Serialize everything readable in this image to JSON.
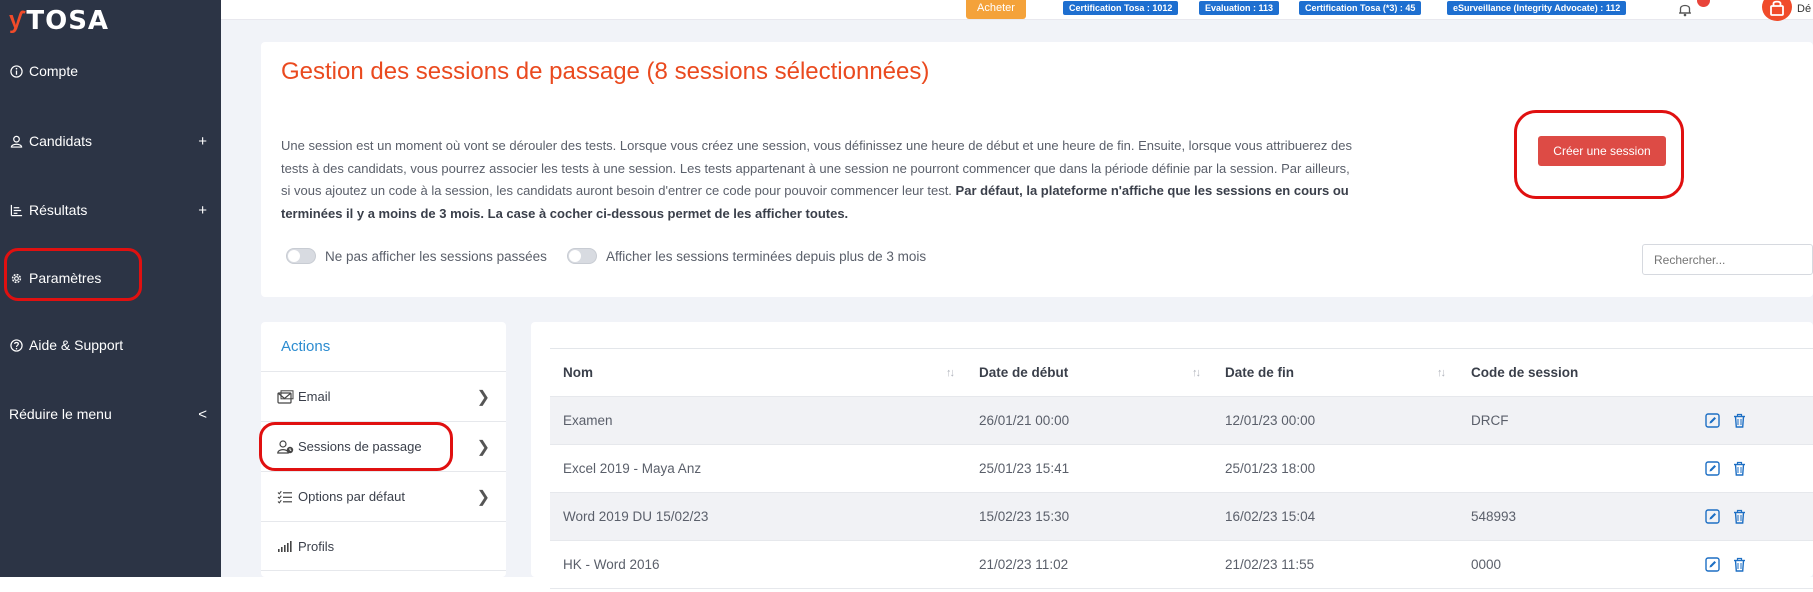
{
  "brand": {
    "name": "TOSA",
    "accent": "#f04b2a"
  },
  "sidebar": {
    "items": [
      {
        "label": "Compte",
        "icon": "info-icon"
      },
      {
        "label": "Candidats",
        "icon": "user-icon",
        "expand": "+"
      },
      {
        "label": "Résultats",
        "icon": "results-icon",
        "expand": "+"
      },
      {
        "label": "Paramètres",
        "icon": "gear-icon"
      },
      {
        "label": "Aide & Support",
        "icon": "help-icon"
      },
      {
        "label": "Réduire le menu",
        "icon": "",
        "expand": "<"
      }
    ]
  },
  "topbar": {
    "buy_label": "Acheter",
    "badges": [
      "Certification Tosa : 1012",
      "Evaluation : 113",
      "Certification Tosa (*3) : 45",
      "eSurveillance (Integrity Advocate) : 112"
    ],
    "user_name": "Dé"
  },
  "header": {
    "title": "Gestion des sessions de passage (8 sessions sélectionnées)",
    "description": "Une session est un moment où vont se dérouler des tests. Lorsque vous créez une session, vous définissez une heure de début et une heure de fin. Ensuite, lorsque vous attribuerez des tests à des candidats, vous pourrez associer les tests à une session. Les tests appartenant à une session ne pourront commencer que dans la période définie par la session. Par ailleurs, si vous ajoutez un code à la session, les candidats auront besoin d'entrer ce code pour pouvoir commencer leur test.",
    "description_bold": "Par défaut, la plateforme n'affiche que les sessions en cours ou terminées il y a moins de 3 mois. La case à cocher ci-dessous permet de les afficher toutes.",
    "create_button": "Créer une session",
    "toggle_past": "Ne pas afficher les sessions passées",
    "toggle_old": "Afficher les sessions terminées depuis plus de 3 mois",
    "search_placeholder": "Rechercher..."
  },
  "actions": {
    "title": "Actions",
    "items": [
      {
        "label": "Email",
        "icon": "email-icon"
      },
      {
        "label": "Sessions de passage",
        "icon": "session-user-icon"
      },
      {
        "label": "Options par défaut",
        "icon": "checklist-icon"
      },
      {
        "label": "Profils",
        "icon": "signal-bars-icon"
      }
    ]
  },
  "table": {
    "columns": [
      "Nom",
      "Date de début",
      "Date de fin",
      "Code de session"
    ],
    "rows": [
      {
        "nom": "Examen",
        "debut": "26/01/21 00:00",
        "fin": "12/01/23 00:00",
        "code": "DRCF"
      },
      {
        "nom": "Excel 2019 - Maya Anz",
        "debut": "25/01/23 15:41",
        "fin": "25/01/23 18:00",
        "code": ""
      },
      {
        "nom": "Word 2019 DU 15/02/23",
        "debut": "15/02/23 15:30",
        "fin": "16/02/23 15:04",
        "code": "548993"
      },
      {
        "nom": "HK - Word 2016",
        "debut": "21/02/23 11:02",
        "fin": "21/02/23 11:55",
        "code": "0000"
      }
    ]
  },
  "colors": {
    "title": "#ea4a1f",
    "sidebar": "#2c3445",
    "primary_button": "#dd4b45",
    "badge": "#1e6fd0",
    "link": "#2c8cd0"
  }
}
